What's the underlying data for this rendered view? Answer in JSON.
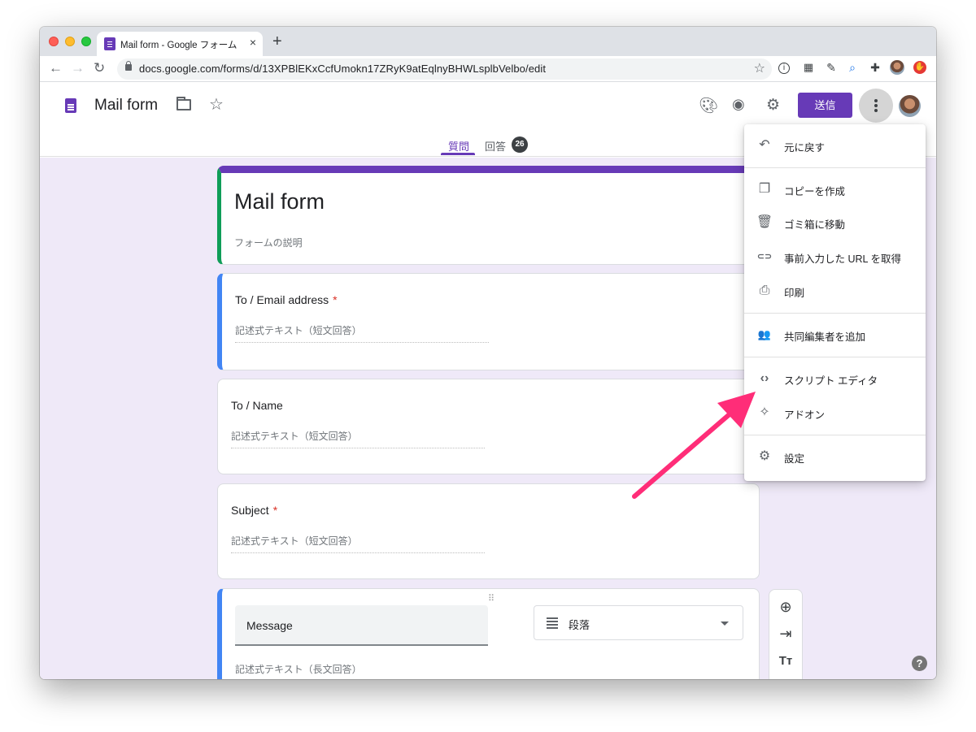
{
  "browser": {
    "tab_title": "Mail form - Google フォーム",
    "tab_close": "×",
    "new_tab": "+",
    "url": "docs.google.com/forms/d/13XPBlEKxCcfUmokn17ZRyK9atEqlnyBHWLsplbVelbo/edit",
    "nav": {
      "back": "←",
      "forward": "→",
      "reload": "↻"
    },
    "url_star": "☆",
    "extensions": [
      "info-icon",
      "qr-icon",
      "eyedropper-icon",
      "search-icon",
      "puzzle-icon",
      "profile-icon",
      "adblock-icon"
    ]
  },
  "header": {
    "form_name": "Mail form",
    "star": "☆",
    "send_label": "送信",
    "icons": [
      "palette-icon",
      "preview-eye-icon",
      "settings-gear-icon",
      "more-vert-icon"
    ]
  },
  "tabs": {
    "questions": "質問",
    "responses": "回答",
    "responses_count": "26"
  },
  "form": {
    "title": "Mail form",
    "description": "フォームの説明",
    "questions": [
      {
        "title": "To / Email address",
        "required_mark": "*",
        "hint": "記述式テキスト（短文回答）"
      },
      {
        "title": "To / Name",
        "hint": "記述式テキスト（短文回答）"
      },
      {
        "title": "Subject",
        "required_mark": "*",
        "hint": "記述式テキスト（短文回答）"
      },
      {
        "title": "Message",
        "type": "段落",
        "hint": "記述式テキスト（長文回答）"
      }
    ],
    "drag_handle": "⠿"
  },
  "side_toolbar": {
    "add": "⊕",
    "import": "⇥",
    "text": "Tт"
  },
  "help": "?",
  "menu": {
    "items": [
      {
        "label": "元に戻す",
        "icon": "undo-icon",
        "glyph": "↶"
      },
      {
        "label": "コピーを作成",
        "icon": "copy-icon",
        "glyph": "❐"
      },
      {
        "label": "ゴミ箱に移動",
        "icon": "trash-icon",
        "glyph": "🗑"
      },
      {
        "label": "事前入力した URL を取得",
        "icon": "link-icon",
        "glyph": "⊂⊃"
      },
      {
        "label": "印刷",
        "icon": "print-icon",
        "glyph": "⎙"
      },
      {
        "label": "共同編集者を追加",
        "icon": "add-people-icon",
        "glyph": "👥"
      },
      {
        "label": "スクリプト エディタ",
        "icon": "code-icon",
        "glyph": "‹›"
      },
      {
        "label": "アドオン",
        "icon": "puzzle-icon",
        "glyph": "✧"
      },
      {
        "label": "設定",
        "icon": "person-settings-icon",
        "glyph": "⚙"
      }
    ]
  },
  "colors": {
    "brand": "#673ab7",
    "active_question": "#4285f4",
    "annotation_arrow": "#ff2d78"
  }
}
